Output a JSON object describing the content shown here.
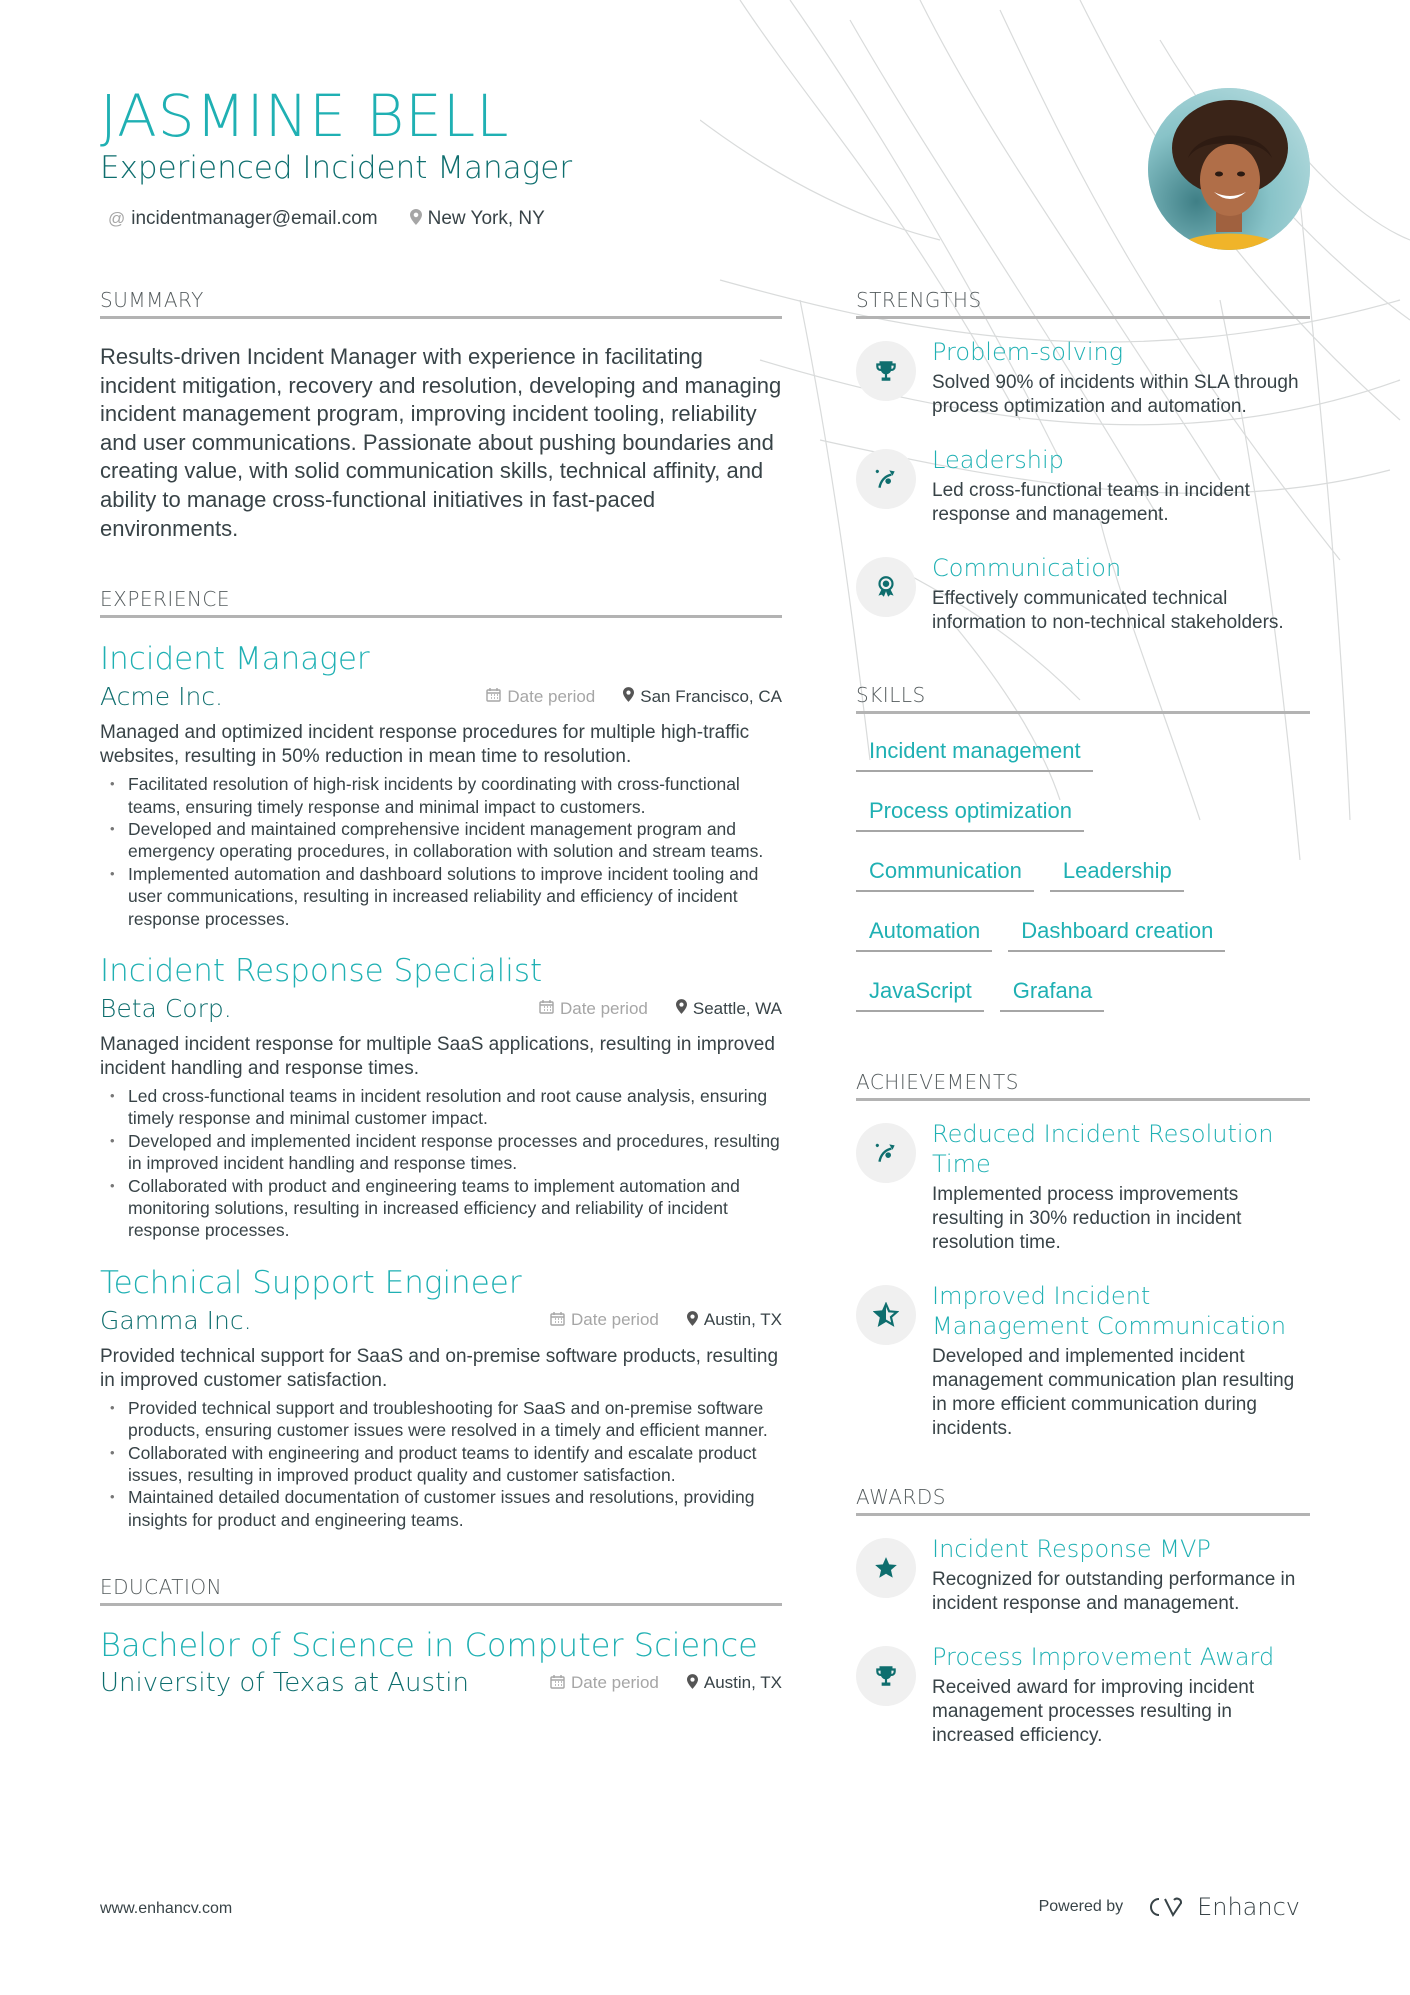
{
  "header": {
    "name": "JASMINE BELL",
    "headline": "Experienced Incident Manager",
    "email": "incidentmanager@email.com",
    "location": "New York, NY",
    "email_icon": "at-icon",
    "location_icon": "map-pin-icon",
    "photo_alt": "Profile photo of Jasmine Bell"
  },
  "summary": {
    "title": "SUMMARY",
    "text": "Results-driven Incident Manager with experience in facilitating incident mitigation, recovery and resolution, developing and managing incident management program, improving incident tooling, reliability and user communications. Passionate about pushing boundaries and creating value, with solid communication skills, technical affinity, and ability to manage cross-functional initiatives in fast-paced environments."
  },
  "experience": {
    "title": "EXPERIENCE",
    "jobs": [
      {
        "title": "Incident Manager",
        "company": "Acme Inc.",
        "date": "Date period",
        "location": "San Francisco, CA",
        "description": "Managed and optimized incident response procedures for multiple high-traffic websites, resulting in 50% reduction in mean time to resolution.",
        "bullets": [
          "Facilitated resolution of high-risk incidents by coordinating with cross-functional teams, ensuring timely response and minimal impact to customers.",
          "Developed and maintained comprehensive incident management program and emergency operating procedures, in collaboration with solution and stream teams.",
          "Implemented automation and dashboard solutions to improve incident tooling and user communications, resulting in increased reliability and efficiency of incident response processes."
        ]
      },
      {
        "title": "Incident Response Specialist",
        "company": "Beta Corp.",
        "date": "Date period",
        "location": "Seattle, WA",
        "description": "Managed incident response for multiple SaaS applications, resulting in improved incident handling and response times.",
        "bullets": [
          "Led cross-functional teams in incident resolution and root cause analysis, ensuring timely response and minimal customer impact.",
          "Developed and implemented incident response processes and procedures, resulting in improved incident handling and response times.",
          "Collaborated with product and engineering teams to implement automation and monitoring solutions, resulting in increased efficiency and reliability of incident response processes."
        ]
      },
      {
        "title": "Technical Support Engineer",
        "company": "Gamma Inc.",
        "date": "Date period",
        "location": "Austin, TX",
        "description": "Provided technical support for SaaS and on-premise software products, resulting in improved customer satisfaction.",
        "bullets": [
          "Provided technical support and troubleshooting for SaaS and on-premise software products, ensuring customer issues were resolved in a timely and efficient manner.",
          "Collaborated with engineering and product teams to identify and escalate product issues, resulting in improved product quality and customer satisfaction.",
          "Maintained detailed documentation of customer issues and resolutions, providing insights for product and engineering teams."
        ]
      }
    ]
  },
  "education": {
    "title": "EDUCATION",
    "degree": "Bachelor of Science in Computer Science",
    "school": "University of Texas at Austin",
    "date": "Date period",
    "location": "Austin, TX"
  },
  "strengths": {
    "title": "STRENGTHS",
    "items": [
      {
        "icon": "trophy-icon",
        "title": "Problem-solving",
        "desc": "Solved 90% of incidents within SLA through process optimization and automation."
      },
      {
        "icon": "strategy-icon",
        "title": "Leadership",
        "desc": "Led cross-functional teams in incident response and management."
      },
      {
        "icon": "medal-icon",
        "title": "Communication",
        "desc": "Effectively communicated technical information to non-technical stakeholders."
      }
    ]
  },
  "skills": {
    "title": "SKILLS",
    "items": [
      "Incident management",
      "Process optimization",
      "Communication",
      "Leadership",
      "Automation",
      "Dashboard creation",
      "JavaScript",
      "Grafana"
    ]
  },
  "achievements": {
    "title": "ACHIEVEMENTS",
    "items": [
      {
        "icon": "strategy-icon",
        "title": "Reduced Incident Resolution Time",
        "desc": "Implemented process improvements resulting in 30% reduction in incident resolution time."
      },
      {
        "icon": "star-half-icon",
        "title": "Improved Incident Management Communication",
        "desc": "Developed and implemented incident management communication plan resulting in more efficient communication during incidents."
      }
    ]
  },
  "awards": {
    "title": "AWARDS",
    "items": [
      {
        "icon": "star-icon",
        "title": "Incident Response MVP",
        "desc": "Recognized for outstanding performance in incident response and management."
      },
      {
        "icon": "trophy-icon",
        "title": "Process Improvement Award",
        "desc": "Received award for improving incident management processes resulting in increased efficiency."
      }
    ]
  },
  "footer": {
    "website": "www.enhancv.com",
    "powered_by": "Powered by",
    "brand": "Enhancv"
  },
  "colors": {
    "accent": "#1fb0b3",
    "accent_dark": "#0e6e6e",
    "text": "#384347",
    "muted": "#a6a6a6",
    "rule": "#b3b3b3"
  }
}
